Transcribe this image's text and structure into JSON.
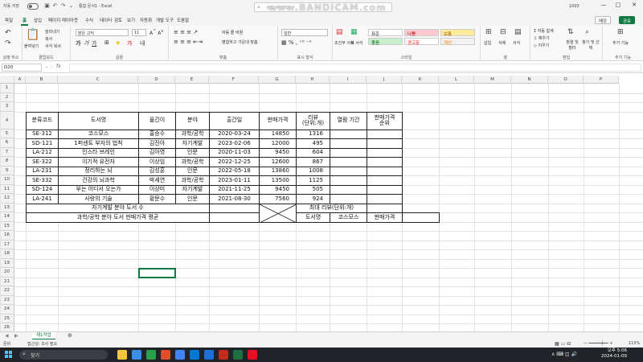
{
  "titlebar": {
    "autosave": "자동 저장",
    "qa_icons": [
      "save-icon",
      "undo-icon",
      "redo-icon",
      "more-icon"
    ],
    "doc": "통합 문서1 - Excel",
    "search_placeholder": "검색 (Alt+Q)",
    "user": "1003",
    "win": [
      "—",
      "□",
      "✕"
    ]
  },
  "watermark": "www.BANDICAM.com",
  "ribbon_tabs": [
    "파일",
    "홈",
    "삽입",
    "페이지 레이아웃",
    "수식",
    "데이터",
    "검토",
    "보기",
    "자동화",
    "개발 도구",
    "도움말"
  ],
  "ribbon_active": "홈",
  "memo_label": "메모",
  "share_label": "공유",
  "ribbon": {
    "groups": [
      "실행 취소",
      "클립보드",
      "글꼴",
      "맞춤",
      "표시 형식",
      "스타일",
      "셀",
      "편집",
      "추가 기능"
    ],
    "paste": "붙여넣기",
    "cut": "잘라내기",
    "copy": "복사",
    "format_painter": "서식 복사",
    "font_name": "맑은 고딕",
    "font_size": "11",
    "wrap": "자동 줄 바꿈",
    "merge": "병합하고 가운데 맞춤",
    "number_format": "일반",
    "cond_format": "조건부 서식",
    "table_format": "표 서식",
    "styles": [
      {
        "label": "표준",
        "bg": "#ffffff",
        "fg": "#222222"
      },
      {
        "label": "나쁨",
        "bg": "#ffc7ce",
        "fg": "#9c0006"
      },
      {
        "label": "보통",
        "bg": "#ffeb9c",
        "fg": "#9c5700"
      },
      {
        "label": "좋음",
        "bg": "#c6efce",
        "fg": "#006100"
      },
      {
        "label": "경고문",
        "bg": "#ffffff",
        "fg": "#ff0000"
      },
      {
        "label": "계산",
        "bg": "#f2f2f2",
        "fg": "#fa7d00"
      }
    ],
    "insert": "삽입",
    "delete": "삭제",
    "format": "서식",
    "autosum": "자동 합계",
    "fill": "채우기",
    "clear": "지우기",
    "sort_filter": "정렬 및 필터",
    "find_select": "찾기 및 선택",
    "addins": "추가 기능"
  },
  "formula_bar": {
    "name_box": "D20",
    "fx": "fx",
    "value": ""
  },
  "columns": [
    "A",
    "B",
    "C",
    "D",
    "E",
    "F",
    "G",
    "H",
    "I",
    "J",
    "K",
    "L",
    "M",
    "N",
    "O",
    "P"
  ],
  "rows": [
    "1",
    "2",
    "3",
    "4",
    "5",
    "6",
    "7",
    "8",
    "9",
    "10",
    "11",
    "12",
    "13",
    "14",
    "15",
    "16",
    "17",
    "18",
    "19",
    "20",
    "21",
    "22",
    "23",
    "24",
    "25",
    "26"
  ],
  "table": {
    "headers": [
      "분류코드",
      "도서명",
      "옮긴이",
      "분야",
      "출간일",
      "판매가격",
      "리뷰\n(단위:개)",
      "열람 기간",
      "판매가격\n순위"
    ],
    "rows": [
      [
        "SE-312",
        "코스모스",
        "홍승수",
        "과학/공학",
        "2020-03-24",
        "14850",
        "1316",
        "",
        ""
      ],
      [
        "SD-121",
        "1퍼센트 부자의 법칙",
        "김진아",
        "자기계발",
        "2023-02-06",
        "12000",
        "495",
        "",
        ""
      ],
      [
        "LA-212",
        "인스타 브레인",
        "김아영",
        "인문",
        "2020-11-03",
        "9450",
        "604",
        "",
        ""
      ],
      [
        "SE-322",
        "이기적 유전자",
        "이상임",
        "과학/공학",
        "2022-12-25",
        "12600",
        "867",
        "",
        ""
      ],
      [
        "LA-231",
        "정리하는 뇌",
        "김성훈",
        "인문",
        "2022-05-18",
        "13860",
        "1008",
        "",
        ""
      ],
      [
        "SE-332",
        "건강의 뇌과학",
        "박세연",
        "과학/공학",
        "2023-01-11",
        "13500",
        "1125",
        "",
        ""
      ],
      [
        "SD-124",
        "부는 어디서 오는가",
        "이상미",
        "자기계발",
        "2021-11-25",
        "9450",
        "505",
        "",
        ""
      ],
      [
        "LA-241",
        "사랑의 기술",
        "황문수",
        "인문",
        "2021-08-30",
        "7560",
        "924",
        "",
        ""
      ]
    ],
    "row13_label": "자기계발 분야 도서 수",
    "row14_label": "과학/공학 분야 도서 판매가격 평균",
    "max_review_label": "최대 리뷰(단위:개)",
    "lookup_label": "도서명",
    "lookup_value": "코스모스",
    "lookup_result_label": "판매가격"
  },
  "sheet_tab": "제1작업",
  "status": {
    "ready": "준비",
    "access": "접근성: 조사 필요",
    "zoom": "115%"
  },
  "taskbar": {
    "search": "찾기",
    "apps": [
      "#f4c542",
      "#3a8ee6",
      "#2aa04a",
      "#e34c26",
      "#4285f4",
      "#0078d4",
      "#1e6fd9",
      "#c42b1c",
      "#1d6f42",
      "#e81123"
    ],
    "tray": "∧  ⌨  ◫  🔊",
    "time": "오후 5:06",
    "date": "2024-01-09"
  }
}
